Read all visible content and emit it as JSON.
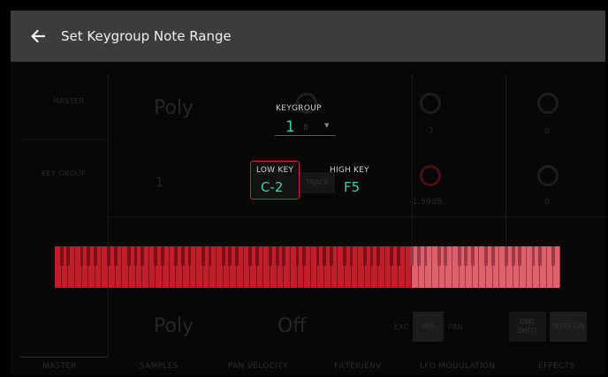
{
  "header": {
    "title": "Set Keygroup Note Range"
  },
  "dialog": {
    "keygroup_label": "KEYGROUP",
    "keygroup_value": "1",
    "keygroup_of": "8",
    "low_key_label": "LOW KEY",
    "low_key_value": "C-2",
    "high_key_label": "HIGH KEY",
    "high_key_value": "F5"
  },
  "background": {
    "sidebar": [
      "MASTER",
      "KEY GROUP"
    ],
    "poly_top": "Poly",
    "kg_num": "1",
    "poly_bottom": "Poly",
    "off_text": "Off",
    "readout_minus7": "-7",
    "readout_db": "-1.59dB",
    "readout_zero1": "0",
    "readout_zero2": "0",
    "track_btn": "TRACK",
    "exc_label": "EXC",
    "vel_btn": "VEL",
    "pan_label": "PAN",
    "oneshot_btn": "ONE SHOT",
    "noteon_btn": "NOTE ON"
  },
  "keyboard": {
    "range_low": "C-2",
    "range_high": "F5",
    "selected_color": "#c11e2b",
    "unselected_color": "#de626e"
  },
  "tabs": [
    "MASTER",
    "SAMPLES",
    "PAN VELOCITY",
    "FILTER/ENV",
    "LFO MODULATION",
    "EFFECTS"
  ],
  "colors": {
    "accent": "#3fcfa3",
    "highlight": "#c1272d"
  }
}
